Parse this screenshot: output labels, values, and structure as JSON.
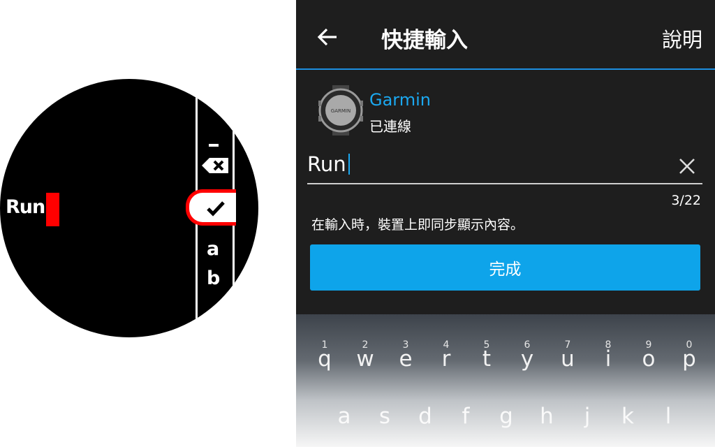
{
  "watch": {
    "entry_text": "Run",
    "keys": {
      "dash": "–",
      "letter_a": "a",
      "letter_b": "b"
    },
    "colors": {
      "accent": "#ff0000",
      "background": "#000000",
      "foreground": "#ffffff"
    },
    "icons": [
      "backspace-icon",
      "checkmark-icon"
    ]
  },
  "phone": {
    "header": {
      "title": "快捷輸入",
      "help_label": "說明",
      "back_icon": "arrow-left-icon"
    },
    "device": {
      "name": "Garmin",
      "status": "已連線",
      "icon": "garmin-watch-icon",
      "brand_text": "GARMIN"
    },
    "input": {
      "value": "Run",
      "counter": "3/22",
      "clear_icon": "close-icon"
    },
    "hint": "在輸入時，裝置上即同步顯示內容。",
    "done_button": "完成",
    "colors": {
      "background": "#1e1e1e",
      "accent": "#1ba8f0",
      "button": "#0ea4ea",
      "divider": "#1d8fe0"
    },
    "keyboard": {
      "row1": [
        {
          "num": "1",
          "ch": "q"
        },
        {
          "num": "2",
          "ch": "w"
        },
        {
          "num": "3",
          "ch": "e"
        },
        {
          "num": "4",
          "ch": "r"
        },
        {
          "num": "5",
          "ch": "t"
        },
        {
          "num": "6",
          "ch": "y"
        },
        {
          "num": "7",
          "ch": "u"
        },
        {
          "num": "8",
          "ch": "i"
        },
        {
          "num": "9",
          "ch": "o"
        },
        {
          "num": "0",
          "ch": "p"
        }
      ],
      "row2": [
        "a",
        "s",
        "d",
        "f",
        "g",
        "h",
        "j",
        "k",
        "l"
      ]
    }
  }
}
